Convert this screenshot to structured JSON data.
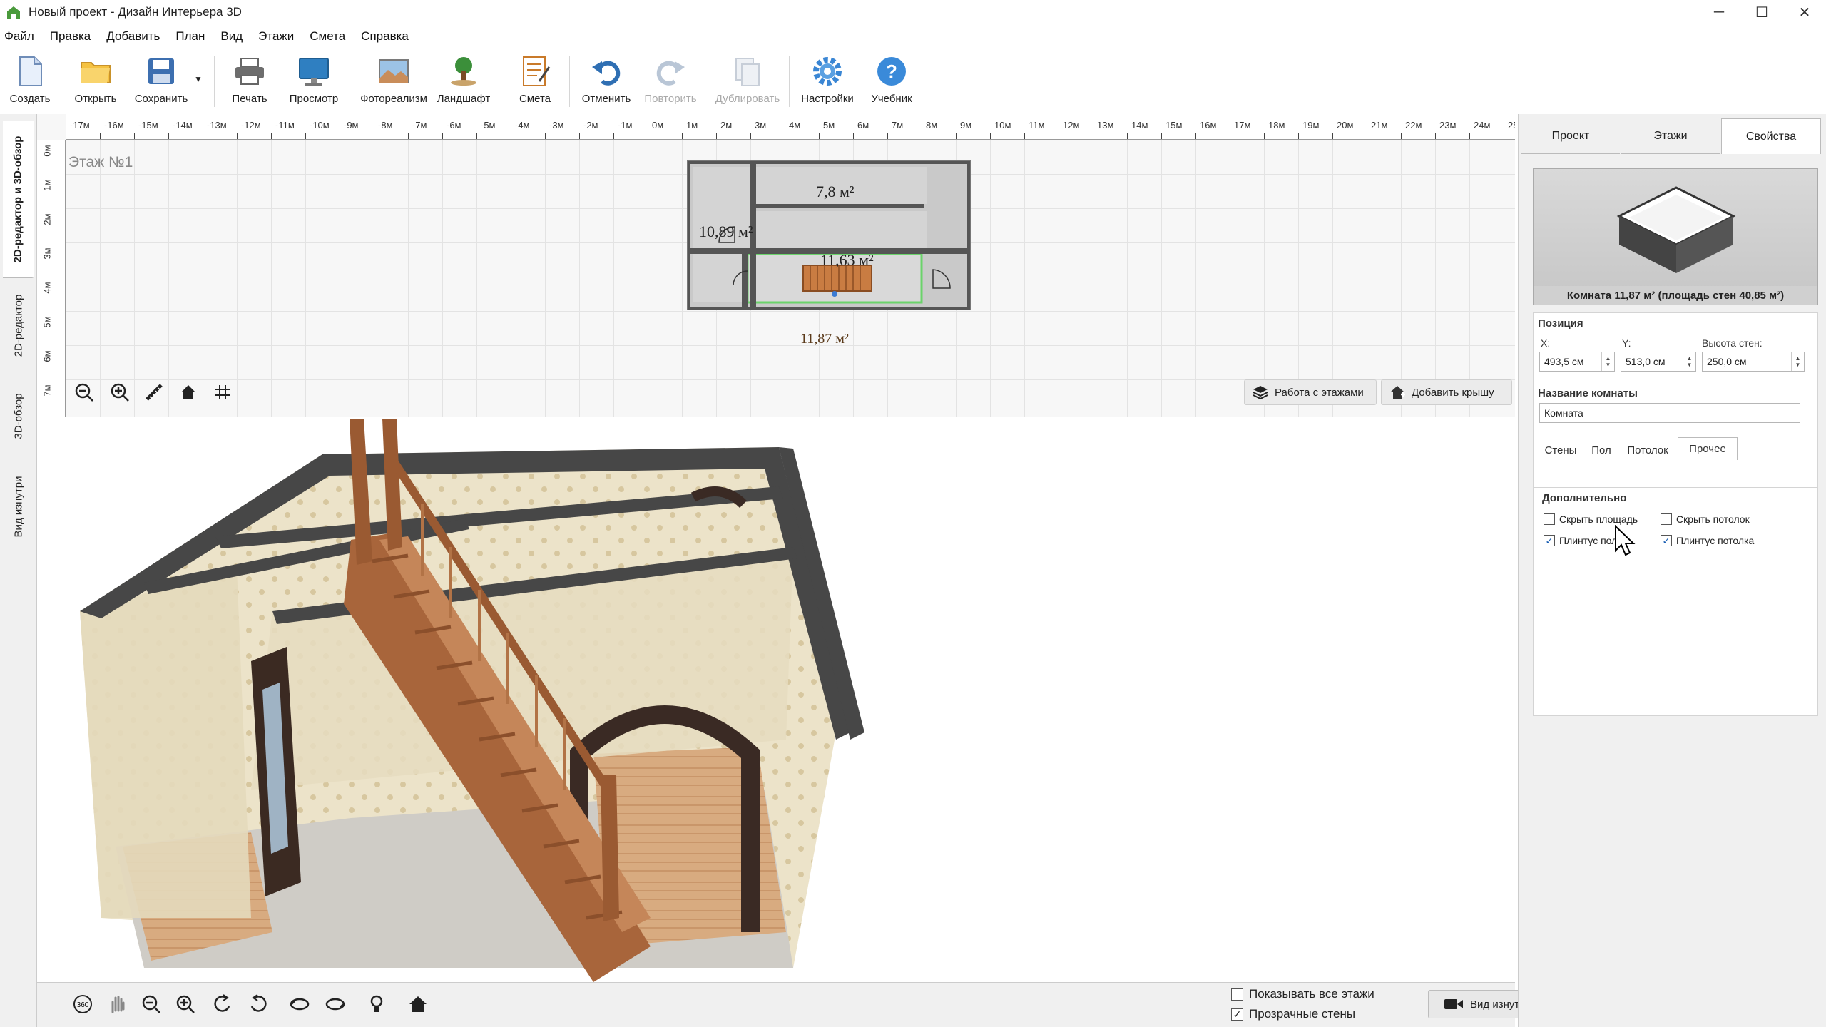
{
  "window": {
    "title": "Новый проект - Дизайн Интерьера 3D",
    "controls": [
      "─",
      "☐",
      "✕"
    ]
  },
  "menu": [
    "Файл",
    "Правка",
    "Добавить",
    "План",
    "Вид",
    "Этажи",
    "Смета",
    "Справка"
  ],
  "toolbar": {
    "create": "Создать",
    "open": "Открыть",
    "save": "Сохранить",
    "print": "Печать",
    "preview": "Просмотр",
    "photo": "Фотореализм",
    "landscape": "Ландшафт",
    "estimate": "Смета",
    "undo": "Отменить",
    "redo": "Повторить",
    "duplicate": "Дублировать",
    "settings": "Настройки",
    "tutorial": "Учебник"
  },
  "vtabs": [
    "2D-редактор и 3D-обзор",
    "2D-редактор",
    "3D-обзор",
    "Вид изнутри"
  ],
  "plan": {
    "floor_label": "Этаж №1",
    "hruler": [
      "-17м",
      "-16м",
      "-15м",
      "-14м",
      "-13м",
      "-12м",
      "-11м",
      "-10м",
      "-9м",
      "-8м",
      "-7м",
      "-6м",
      "-5м",
      "-4м",
      "-3м",
      "-2м",
      "-1м",
      "0м",
      "1м",
      "2м",
      "3м",
      "4м",
      "5м",
      "6м",
      "7м",
      "8м",
      "9м",
      "10м",
      "11м",
      "12м",
      "13м",
      "14м",
      "15м",
      "16м",
      "17м",
      "18м",
      "19м",
      "20м",
      "21м",
      "22м",
      "23м",
      "24м",
      "25"
    ],
    "vruler": [
      "0м",
      "1м",
      "2м",
      "3м",
      "4м",
      "5м",
      "6м",
      "7м"
    ],
    "rooms": [
      "7,8 м²",
      "10,89 м²",
      "11,63 м²",
      "11,87 м²"
    ],
    "btn_floors": "Работа с этажами",
    "btn_roof": "Добавить крышу"
  },
  "bottom": {
    "show_all_floors": "Показывать все этажи",
    "transparent_walls": "Прозрачные стены",
    "inside_view": "Вид изнутри"
  },
  "rpanel": {
    "tabs": [
      "Проект",
      "Этажи",
      "Свойства"
    ],
    "preview_caption": "Комната 11,87 м² (площадь стен 40,85 м²)",
    "position_title": "Позиция",
    "x_label": "X:",
    "x_value": "493,5 см",
    "y_label": "Y:",
    "y_value": "513,0 см",
    "h_label": "Высота стен:",
    "h_value": "250,0 см",
    "name_title": "Название комнаты",
    "name_value": "Комната",
    "subtabs": [
      "Стены",
      "Пол",
      "Потолок",
      "Прочее"
    ],
    "extra_title": "Дополнительно",
    "hide_area": "Скрыть площадь",
    "hide_ceiling": "Скрыть потолок",
    "floor_plinth": "Плинтус пола",
    "ceiling_plinth": "Плинтус потолка"
  },
  "checkbox_states": {
    "hide_area": false,
    "hide_ceiling": false,
    "floor_plinth": true,
    "ceiling_plinth": true,
    "show_all_floors": false,
    "transparent_walls": true
  },
  "colors": {
    "accent_blue": "#1a5fb4",
    "wall_dark": "#4a4a4a",
    "stair_wood": "#b06a3c",
    "floor_wood": "#d6a77a"
  }
}
